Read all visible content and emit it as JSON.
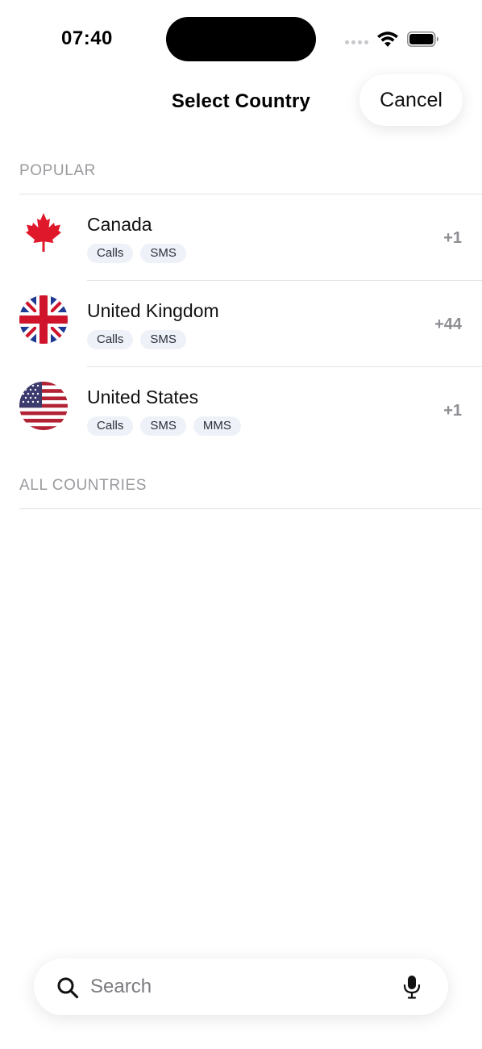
{
  "status_bar": {
    "time": "07:40"
  },
  "header": {
    "title": "Select Country",
    "cancel_label": "Cancel"
  },
  "sections": {
    "popular": "POPULAR",
    "all": "ALL COUNTRIES"
  },
  "countries": [
    {
      "name": "Canada",
      "code": "+1",
      "tags": [
        "Calls",
        "SMS"
      ],
      "flag_icon": "canada-flag-icon"
    },
    {
      "name": "United Kingdom",
      "code": "+44",
      "tags": [
        "Calls",
        "SMS"
      ],
      "flag_icon": "uk-flag-icon"
    },
    {
      "name": "United States",
      "code": "+1",
      "tags": [
        "Calls",
        "SMS",
        "MMS"
      ],
      "flag_icon": "us-flag-icon"
    }
  ],
  "search": {
    "placeholder": "Search",
    "value": ""
  },
  "colors": {
    "canada_red": "#e0182b",
    "uk_blue": "#1f3a93",
    "uk_red": "#cf142b",
    "us_red": "#b22234",
    "us_blue": "#3c3b6e",
    "tag_bg": "#eef1f8",
    "muted": "#8e8e93"
  }
}
